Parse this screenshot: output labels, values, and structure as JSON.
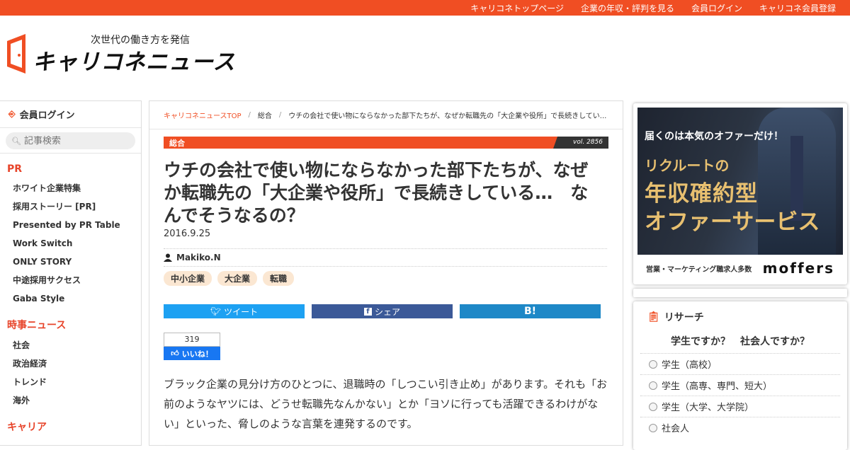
{
  "topnav": [
    "キャリコネトップページ",
    "企業の年収・評判を見る",
    "会員ログイン",
    "キャリコネ会員登録"
  ],
  "logo": {
    "tagline": "次世代の働き方を発信",
    "wordmark": "キャリコネニュース"
  },
  "sidebar": {
    "login": "会員ログイン",
    "search_placeholder": "記事検索",
    "sections": [
      {
        "title": "PR",
        "items": [
          "ホワイト企業特集",
          "採用ストーリー [PR]",
          "Presented by PR Table",
          "Work Switch",
          "ONLY STORY",
          "中途採用サクセス",
          "Gaba Style"
        ]
      },
      {
        "title": "時事ニュース",
        "items": [
          "社会",
          "政治経済",
          "トレンド",
          "海外"
        ]
      },
      {
        "title": "キャリア",
        "items": []
      }
    ]
  },
  "breadcrumb": {
    "top": "キャリコネニュースTOP",
    "category": "総合",
    "current": "ウチの会社で使い物にならなかった部下たちが、なぜか転職先の「大企業や役所」で長続きしてい..."
  },
  "article": {
    "category": "総合",
    "vol": "vol. 2856",
    "title": "ウチの会社で使い物にならなかった部下たちが、なぜか転職先の「大企業や役所」で長続きしている…　なんでそうなるの？",
    "date": "2016.9.25",
    "author": "Makiko.N",
    "tags": [
      "中小企業",
      "大企業",
      "転職"
    ],
    "share": {
      "tweet": "ツイート",
      "facebook": "シェア",
      "hatena": "B!"
    },
    "like": {
      "count": "319",
      "label": "いいね！"
    },
    "body": "ブラック企業の見分け方のひとつに、退職時の「しつこい引き止め」があります。それも「お前のようなヤツには、どうせ転職先なんかない」とか「ヨソに行っても活躍できるわけがない」といった、脅しのような言葉を連発するのです。"
  },
  "ad": {
    "line1": "届くのは本気のオファーだけ！",
    "line2": "リクルートの",
    "line3": "年収確約型",
    "line4": "オファーサービス",
    "footer_text": "営業・マーケティング職求人多数",
    "brand": "moffers"
  },
  "research": {
    "heading": "リサーチ",
    "question": "学生ですか？　社会人ですか？",
    "options": [
      "学生（高校）",
      "学生（高専、専門、短大）",
      "学生（大学、大学院）",
      "社会人"
    ]
  },
  "colors": {
    "accent": "#f04e23",
    "twitter": "#1da1f2",
    "facebook": "#3b5998",
    "hatena": "#1e88c7"
  }
}
